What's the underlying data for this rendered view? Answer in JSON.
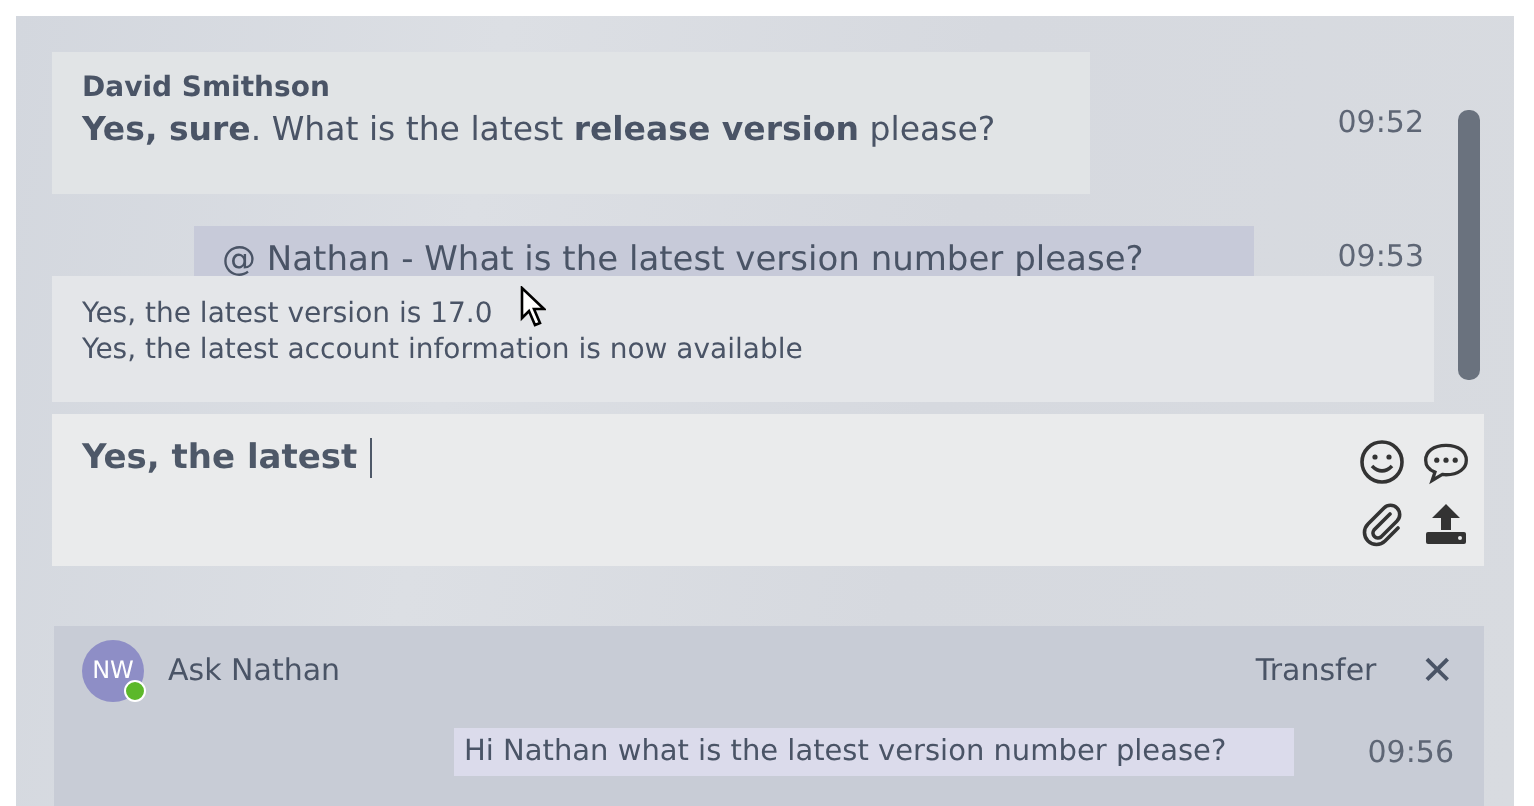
{
  "messages": [
    {
      "sender": "David Smithson",
      "text": "**Yes, sure**. What is the latest **release version** please?",
      "time": "09:52",
      "kind": "incoming"
    },
    {
      "text": "@ Nathan - What is the latest version number please?",
      "time": "09:53",
      "kind": "outgoing"
    }
  ],
  "suggestions": [
    "Yes, the latest version is 17.0",
    "Yes, the latest account information is now available"
  ],
  "composer": {
    "value": "Yes, the latest "
  },
  "ask_panel": {
    "initials": "NW",
    "online": true,
    "title": "Ask Nathan",
    "transfer": "Transfer",
    "close": "✕",
    "message": {
      "text": "Hi Nathan what is the latest version number please?",
      "time": "09:56"
    }
  }
}
